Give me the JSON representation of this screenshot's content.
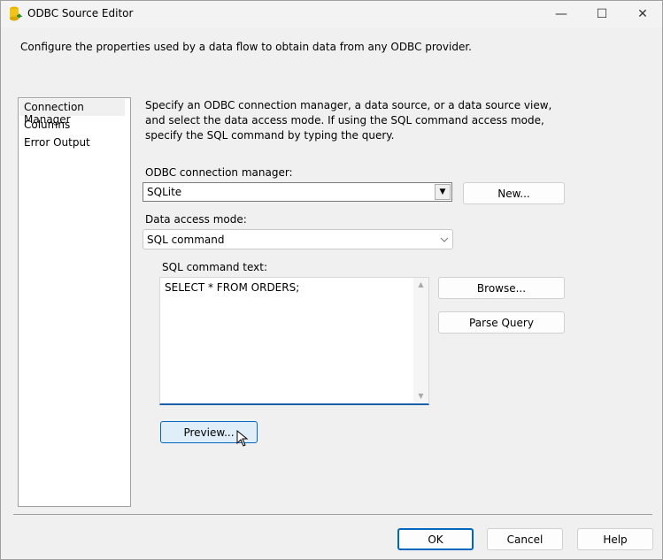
{
  "window": {
    "title": "ODBC Source Editor",
    "minimize": "—",
    "maximize": "☐",
    "close": "✕"
  },
  "description": "Configure the properties used by a data flow to obtain data from any ODBC provider.",
  "nav": {
    "items": [
      {
        "label": "Connection Manager"
      },
      {
        "label": "Columns"
      },
      {
        "label": "Error Output"
      }
    ]
  },
  "main": {
    "instructions": "Specify an ODBC connection manager, a data source, or a data source view, and select the data access mode. If using the SQL command access mode, specify the SQL command by typing the query.",
    "conn_label": "ODBC connection manager:",
    "conn_value": "SQLite",
    "new_label": "New...",
    "mode_label": "Data access mode:",
    "mode_value": "SQL command",
    "sql_label": "SQL command text:",
    "sql_value": "SELECT * FROM ORDERS;",
    "browse_label": "Browse...",
    "parse_label": "Parse Query",
    "preview_label": "Preview..."
  },
  "footer": {
    "ok": "OK",
    "cancel": "Cancel",
    "help": "Help"
  }
}
